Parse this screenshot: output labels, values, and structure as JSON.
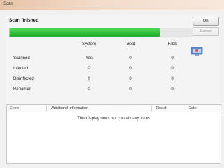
{
  "window": {
    "title": "Scan"
  },
  "status": {
    "label": "Scan finished",
    "progress_fraction": 0.82
  },
  "buttons": {
    "ok": "OK",
    "cancel": "Cancel"
  },
  "stats": {
    "columns": [
      "System",
      "Boot",
      "Files"
    ],
    "rows": [
      {
        "label": "Scanned",
        "values": [
          "Yes",
          "0",
          "0"
        ]
      },
      {
        "label": "Infected",
        "values": [
          "0",
          "0",
          "0"
        ]
      },
      {
        "label": "Disinfected",
        "values": [
          "0",
          "0",
          "0"
        ]
      },
      {
        "label": "Renamed",
        "values": [
          "0",
          "0",
          "0"
        ]
      }
    ]
  },
  "grid": {
    "columns": [
      "Event",
      "Additional information",
      "Result",
      "Date"
    ],
    "empty_message": "This display does not contain any items"
  },
  "colors": {
    "progress": "#2fbf3a",
    "title_bar": "#f2dccb"
  },
  "icons": {
    "scanner": "scanner-monitor-icon"
  }
}
